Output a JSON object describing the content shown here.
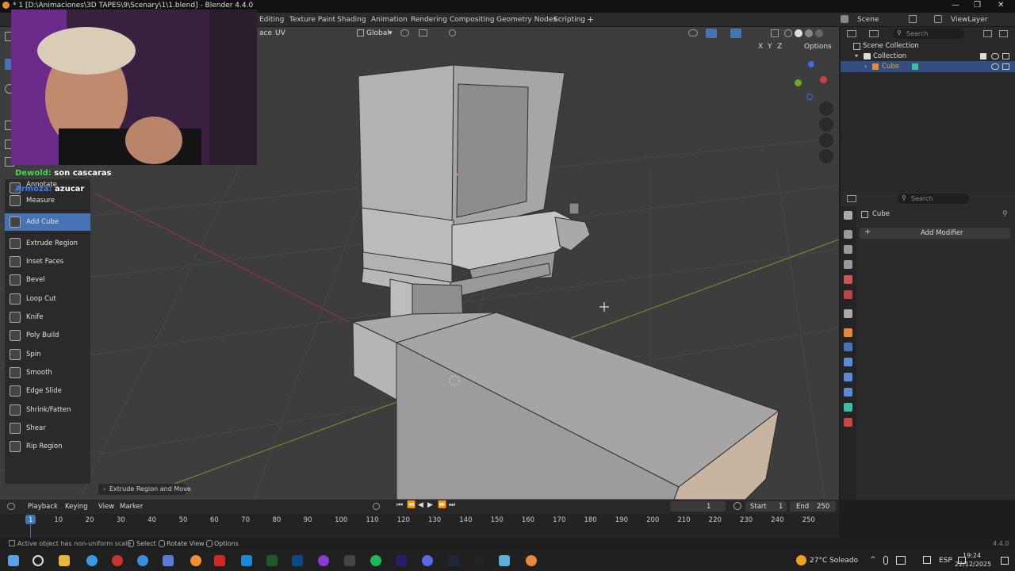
{
  "window": {
    "title": "* 1 [D:\\Animaciones\\3D TAPES\\9\\Scenary\\1\\1.blend] - Blender 4.4.0"
  },
  "workspaces": [
    "Editing",
    "Texture Paint",
    "Shading",
    "Animation",
    "Rendering",
    "Compositing",
    "Geometry Nodes",
    "Scripting"
  ],
  "scene": {
    "label": "Scene",
    "viewlayer": "ViewLayer"
  },
  "viewport_header": {
    "face_label": "ace",
    "uv_label": "UV",
    "transform": "Global",
    "options": "Options",
    "axes": [
      "X",
      "Y",
      "Z"
    ]
  },
  "chat": [
    {
      "user": "Dewold:",
      "message": "son cascaras",
      "color": "#3fdc4a"
    },
    {
      "user": "Armoza:",
      "message": "azucar",
      "color": "#3f7bff"
    }
  ],
  "toolbar": {
    "items": [
      "Annotate",
      "Measure",
      "Add Cube",
      "Extrude Region",
      "Inset Faces",
      "Bevel",
      "Loop Cut",
      "Knife",
      "Poly Build",
      "Spin",
      "Smooth",
      "Edge Slide",
      "Shrink/Fatten",
      "Shear",
      "Rip Region"
    ],
    "selected": "Add Cube"
  },
  "operator_panel": "Extrude Region and Move",
  "outliner": {
    "search_placeholder": "Search",
    "scene_collection": "Scene Collection",
    "collection": "Collection",
    "object": "Cube"
  },
  "properties": {
    "search_placeholder": "Search",
    "object_name": "Cube",
    "add_modifier": "Add Modifier"
  },
  "timeline": {
    "menus": [
      "Playback",
      "Keying",
      "View",
      "Marker"
    ],
    "current_frame": "1",
    "start_label": "Start",
    "start": "1",
    "end_label": "End",
    "end": "250",
    "ticks": [
      "1",
      "10",
      "20",
      "30",
      "40",
      "50",
      "60",
      "70",
      "80",
      "90",
      "100",
      "110",
      "120",
      "130",
      "140",
      "150",
      "160",
      "170",
      "180",
      "190",
      "200",
      "210",
      "220",
      "230",
      "240",
      "250"
    ]
  },
  "status": {
    "message": "Active object has non-uniform scale",
    "select": "Select",
    "rotate": "Rotate View",
    "options": "Options",
    "version": "4.4.0"
  },
  "taskbar": {
    "weather": "27°C Soleado",
    "lang": "ESP",
    "time": "19:24",
    "date": "22/12/2025"
  },
  "colors": {
    "accent": "#4772b3",
    "active": "#e8883a",
    "grid_x": "#8a3a3a",
    "grid_y": "#6b8a2a"
  }
}
